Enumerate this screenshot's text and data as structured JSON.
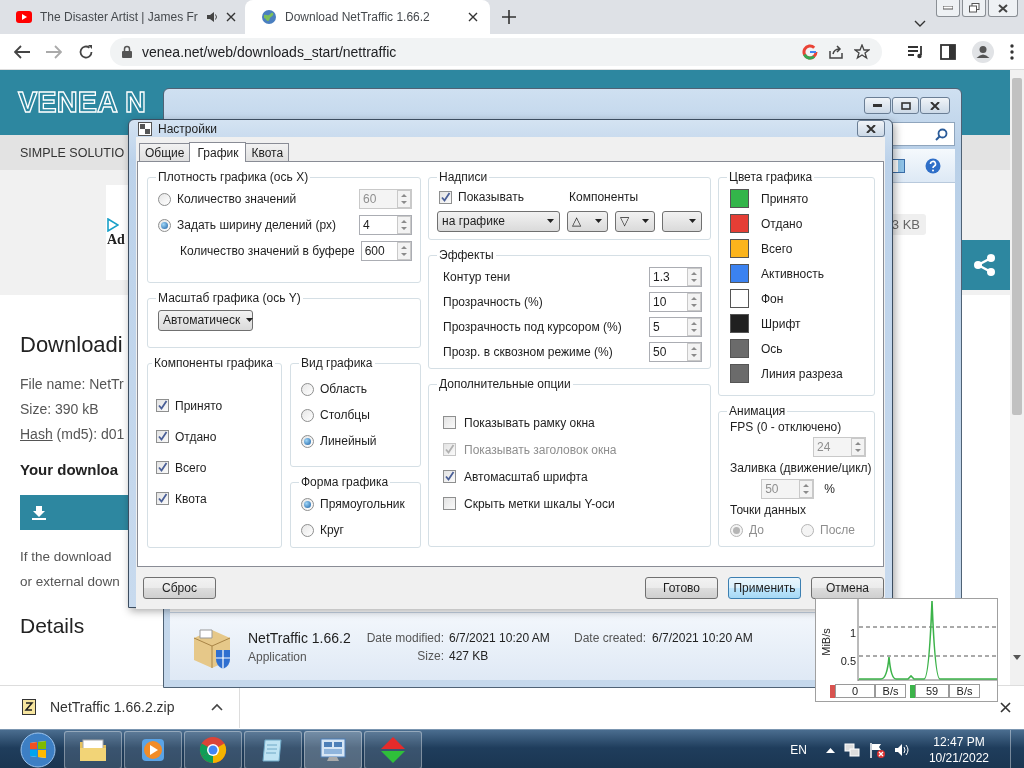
{
  "browser": {
    "tabs": [
      {
        "title": "The Disaster Artist | James Fr",
        "selected": false,
        "audio": true
      },
      {
        "title": "Download NetTraffic 1.66.2",
        "selected": true,
        "audio": false
      }
    ],
    "address": "venea.net/web/downloads_start/nettraffic"
  },
  "page": {
    "logo": "VENEA N",
    "nav": "SIMPLE SOLUTIO",
    "ad_label": "Ad",
    "heading": "Downloadi",
    "file_name": "File name: NetTr",
    "size": "Size: 390 kB",
    "hash_link": "Hash",
    "hash_rest": " (md5): d01",
    "your_download": "Your downloa",
    "note_lines": [
      "If the download",
      "or external down"
    ],
    "details": "Details"
  },
  "shelf": {
    "file": "NetTraffic 1.66.2.zip"
  },
  "explorer": {
    "list_size": "3 KB",
    "file": {
      "name": "NetTraffic 1.66.2",
      "type": "Application",
      "modified_label": "Date modified:",
      "modified": "6/7/2021 10:20 AM",
      "size_label": "Size:",
      "size": "427 KB",
      "created_label": "Date created:",
      "created": "6/7/2021 10:20 AM"
    }
  },
  "settings": {
    "title": "Настройки",
    "tabs": [
      {
        "label": "Общие",
        "selected": false
      },
      {
        "label": "График",
        "selected": true
      },
      {
        "label": "Квота",
        "selected": false
      }
    ],
    "density": {
      "title": "Плотность графика (ось X)",
      "options": [
        {
          "label": "Количество значений",
          "selected": false,
          "value": "60",
          "value_disabled": true
        },
        {
          "label": "Задать ширину делений (px)",
          "selected": true,
          "value": "4",
          "value_disabled": false
        }
      ],
      "buffer": {
        "label": "Количество значений в буфере",
        "value": "600"
      }
    },
    "scale": {
      "title": "Масштаб графика (ось Y)",
      "value": "Автоматическ"
    },
    "components": {
      "title": "Компоненты графика",
      "items": [
        {
          "label": "Принято",
          "checked": true
        },
        {
          "label": "Отдано",
          "checked": true
        },
        {
          "label": "Всего",
          "checked": true
        },
        {
          "label": "Квота",
          "checked": true
        }
      ]
    },
    "view": {
      "title": "Вид графика",
      "options": [
        {
          "label": "Область",
          "selected": false
        },
        {
          "label": "Столбцы",
          "selected": false
        },
        {
          "label": "Линейный",
          "selected": true
        }
      ]
    },
    "shape": {
      "title": "Форма графика",
      "options": [
        {
          "label": "Прямоугольник",
          "selected": true
        },
        {
          "label": "Круг",
          "selected": false
        }
      ]
    },
    "labels": {
      "title": "Надписи",
      "show": {
        "label": "Показывать",
        "checked": true
      },
      "components_label": "Компоненты",
      "position": "на графике",
      "symbols": [
        "△",
        "▽"
      ],
      "extra_dropdown": true
    },
    "effects": {
      "title": "Эффекты",
      "rows": [
        {
          "label": "Контур тени",
          "value": "1.3"
        },
        {
          "label": "Прозрачность (%)",
          "value": "10"
        },
        {
          "label": "Прозрачность под курсором (%)",
          "value": "5"
        },
        {
          "label": "Прозр. в сквозном режиме (%)",
          "value": "50"
        }
      ]
    },
    "options": {
      "title": "Дополнительные опции",
      "items": [
        {
          "label": "Показывать рамку окна",
          "checked": false,
          "disabled": false
        },
        {
          "label": "Показывать заголовок окна",
          "checked": true,
          "disabled": true
        },
        {
          "label": "Автомасштаб шрифта",
          "checked": true,
          "disabled": false
        },
        {
          "label": "Скрыть метки шкалы Y-оси",
          "checked": false,
          "disabled": false
        }
      ]
    },
    "colors": {
      "title": "Цвета графика",
      "items": [
        {
          "label": "Принято",
          "color": "#33b54a"
        },
        {
          "label": "Отдано",
          "color": "#e53e35"
        },
        {
          "label": "Всего",
          "color": "#fbb41c"
        },
        {
          "label": "Активность",
          "color": "#3b82f0"
        },
        {
          "label": "Фон",
          "color": "#ffffff"
        },
        {
          "label": "Шрифт",
          "color": "#202020"
        },
        {
          "label": "Ось",
          "color": "#6b6b6b"
        },
        {
          "label": "Линия разреза",
          "color": "#6b6b6b"
        }
      ]
    },
    "animation": {
      "title": "Анимация",
      "disabled": true,
      "fps_label": "FPS (0 - отключено)",
      "fps": "24",
      "fill_label": "Заливка (движение/цикл)",
      "fill": "50",
      "fill_unit": "%",
      "points_label": "Точки данных",
      "points": [
        {
          "label": "До",
          "selected": true
        },
        {
          "label": "После",
          "selected": false
        }
      ]
    },
    "left_buttons": [
      {
        "label": "Сброс",
        "highlighted": false
      }
    ],
    "right_buttons": [
      {
        "label": "Готово",
        "highlighted": false
      },
      {
        "label": "Применить",
        "highlighted": true
      },
      {
        "label": "Отмена",
        "highlighted": false
      }
    ]
  },
  "widget": {
    "axis_label": "MiB/s",
    "ticks": [
      "1",
      "0.5"
    ],
    "readings": [
      {
        "value": "0",
        "unit": "B/s",
        "color": "#d9534f"
      },
      {
        "value": "59",
        "unit": "B/s",
        "color": "#3cb34a"
      }
    ]
  },
  "taskbar": {
    "language": "EN",
    "time": "12:47 PM",
    "date": "10/21/2022"
  }
}
